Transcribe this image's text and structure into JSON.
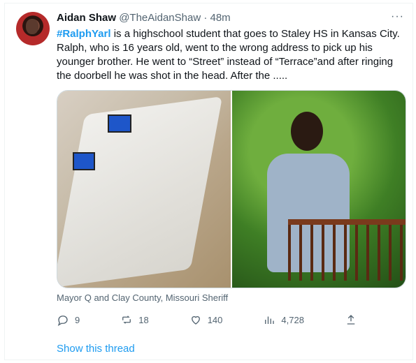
{
  "tweet": {
    "author_name": "Aidan Shaw",
    "handle": "@TheAidanShaw",
    "separator": "·",
    "time": "48m",
    "more": "···",
    "hashtag": "#RalphYarl",
    "text_after_hashtag": " is a highschool student that goes to Staley HS in Kansas City. Ralph, who is 16 years old, went to the wrong address to pick up his younger brother.  He went to “Street” instead of “Terrace”and after ringing the doorbell he was shot in the head.  After the .....",
    "media_credit": "Mayor Q and Clay County, Missouri Sheriff",
    "replies": "9",
    "retweets": "18",
    "likes": "140",
    "views": "4,728",
    "show_thread": "Show this thread"
  },
  "icons": {
    "reply": "reply-icon",
    "retweet": "retweet-icon",
    "like": "heart-icon",
    "views": "views-icon",
    "share": "share-icon"
  },
  "colors": {
    "accent": "#1d9bf0",
    "secondary_text": "#536471"
  }
}
